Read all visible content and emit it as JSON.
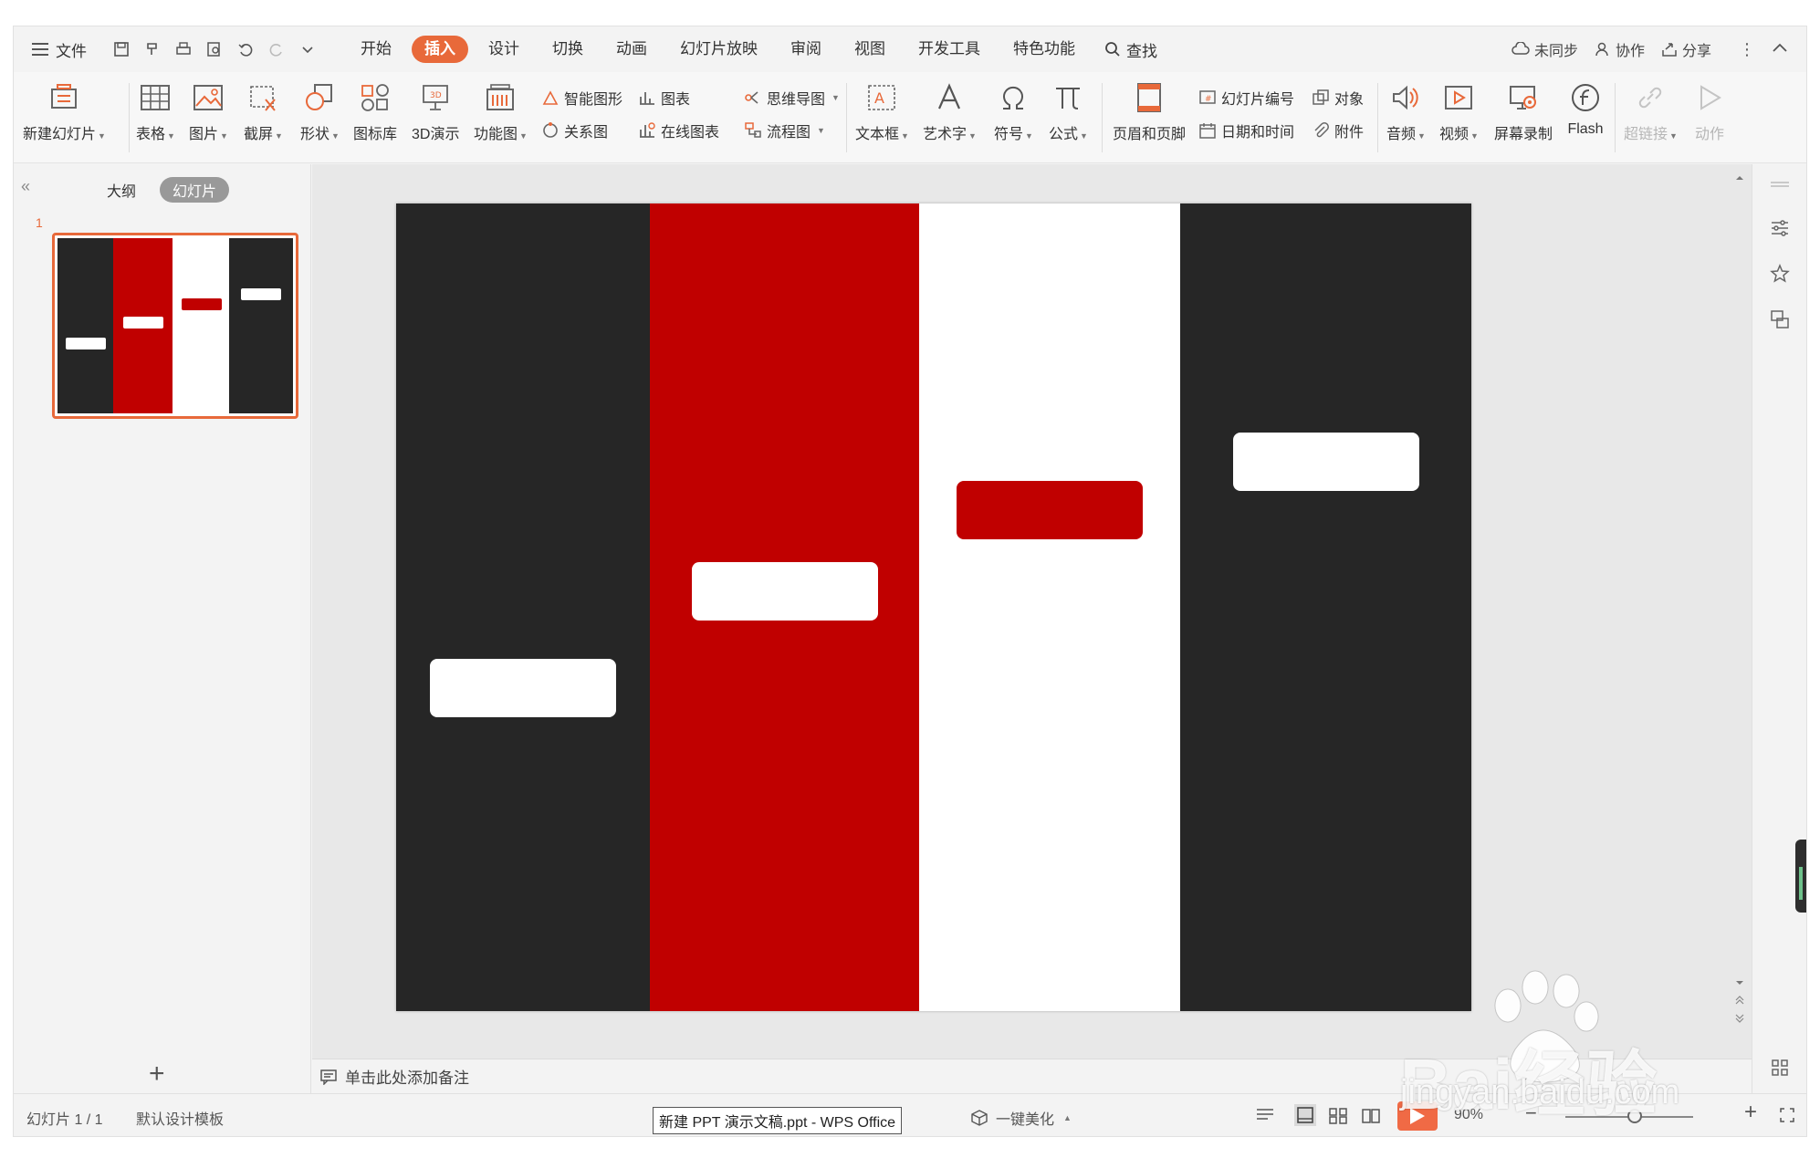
{
  "menubar": {
    "file_label": "文件",
    "tabs": [
      {
        "label": "开始"
      },
      {
        "label": "插入"
      },
      {
        "label": "设计"
      },
      {
        "label": "切换"
      },
      {
        "label": "动画"
      },
      {
        "label": "幻灯片放映"
      },
      {
        "label": "审阅"
      },
      {
        "label": "视图"
      },
      {
        "label": "开发工具"
      },
      {
        "label": "特色功能"
      }
    ],
    "active_tab": "插入",
    "find_label": "查找",
    "sync_label": "未同步",
    "collab_label": "协作",
    "share_label": "分享"
  },
  "ribbon": {
    "new_slide": "新建幻灯片",
    "table": "表格",
    "picture": "图片",
    "screenshot": "截屏",
    "shape": "形状",
    "icon_lib": "图标库",
    "demo3d": "3D演示",
    "func_chart": "功能图",
    "smart_art": "智能图形",
    "chart": "图表",
    "mind_map": "思维导图",
    "relation": "关系图",
    "online_chart": "在线图表",
    "flow_chart": "流程图",
    "text_box": "文本框",
    "word_art": "艺术字",
    "symbol": "符号",
    "formula": "公式",
    "header_footer": "页眉和页脚",
    "slide_number": "幻灯片编号",
    "object": "对象",
    "date_time": "日期和时间",
    "attachment": "附件",
    "audio": "音频",
    "video": "视频",
    "screen_record": "屏幕录制",
    "flash": "Flash",
    "hyperlink": "超链接",
    "action": "动作"
  },
  "leftpanel": {
    "outline_tab": "大纲",
    "slides_tab": "幻灯片",
    "slide_number": "1",
    "collapse": "«",
    "add": "+"
  },
  "slide": {
    "columns": [
      {
        "color": "#262626",
        "box_color": "#ffffff",
        "box_level": 0.4
      },
      {
        "color": "#c00000",
        "box_color": "#ffffff",
        "box_level": 0.52
      },
      {
        "color": "#ffffff",
        "box_color": "#c00000",
        "box_level": 0.62
      },
      {
        "color": "#262626",
        "box_color": "#ffffff",
        "box_level": 0.68
      }
    ]
  },
  "notes": {
    "placeholder": "单击此处添加备注"
  },
  "statusbar": {
    "slide_count": "幻灯片 1 / 1",
    "template": "默认设计模板",
    "filename": "新建 PPT 演示文稿.ppt - WPS Office",
    "beautify": "一键美化",
    "zoom": "90%"
  },
  "watermark": {
    "brand": "Bai经验",
    "url": "jingyan.baidu.com"
  },
  "colors": {
    "accent": "#e8693a",
    "dark": "#262626",
    "red": "#c00000"
  }
}
